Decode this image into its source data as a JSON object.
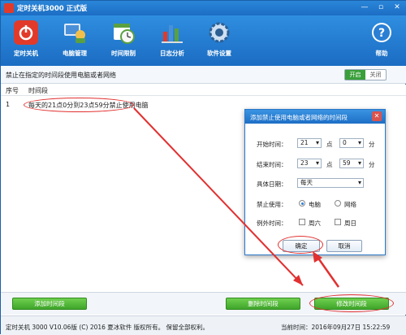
{
  "app": {
    "title": "定时关机3000 正式版"
  },
  "toolbar": [
    {
      "label": "定时关机",
      "icon": "power-icon"
    },
    {
      "label": "电脑管理",
      "icon": "computer-manage-icon"
    },
    {
      "label": "时间限制",
      "icon": "clock-calendar-icon"
    },
    {
      "label": "日志分析",
      "icon": "chart-log-icon"
    },
    {
      "label": "软件设置",
      "icon": "gear-icon"
    },
    {
      "label": "帮助",
      "icon": "help-icon"
    }
  ],
  "section": {
    "title": "禁止在指定的时间段使用电脑或者网络",
    "toggle_on": "开启",
    "toggle_off": "关闭"
  },
  "table": {
    "headers": [
      "序号",
      "时间段"
    ],
    "rows": [
      {
        "no": "1",
        "desc": "每天的21点0分到23点59分禁止使用电脑"
      }
    ]
  },
  "buttons": {
    "add": "添加时间段",
    "delete": "删除时间段",
    "modify": "修改时间段"
  },
  "status": {
    "copyright": "定时关机 3000 V10.06版 (C) 2016  夏冰软件 版权所有。 保留全部权利。",
    "now": "当前时间：2016年09月27日 15:22:59"
  },
  "dialog": {
    "title": "添加禁止使用电脑或者网络的时间段",
    "start_label": "开始时间：",
    "start_hour": "21",
    "start_min": "0",
    "end_label": "结束时间：",
    "end_hour": "23",
    "end_min": "59",
    "hour_unit": "点",
    "min_unit": "分",
    "date_label": "具体日期：",
    "date_value": "每天",
    "forbid_label": "禁止使用：",
    "opt_pc": "电脑",
    "opt_net": "网络",
    "except_label": "例外时间：",
    "opt_sat": "周六",
    "opt_sun": "周日",
    "ok": "确定",
    "cancel": "取消"
  },
  "colors": {
    "titlebar": "#1c6ec3",
    "accent_green": "#3ea52a",
    "annotation_red": "#e23030"
  }
}
